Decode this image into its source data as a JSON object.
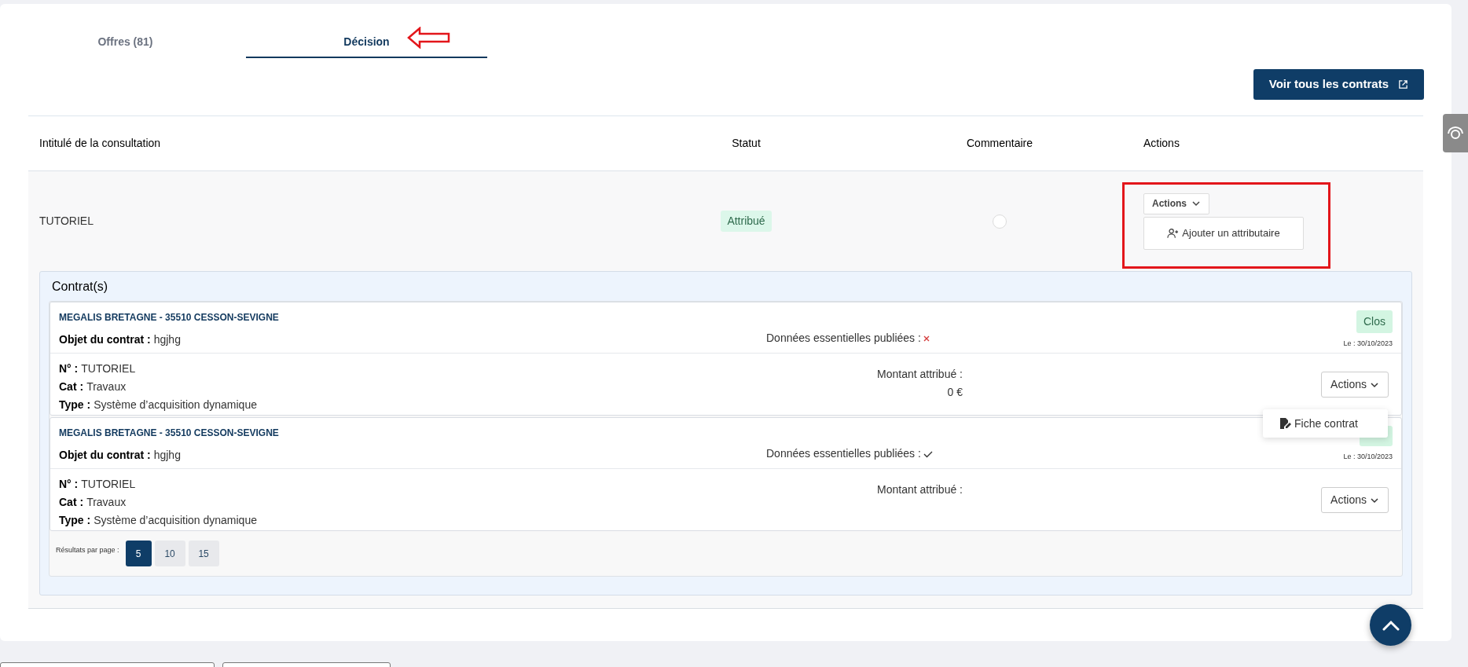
{
  "tabs": [
    {
      "label": "Offres (81)",
      "selected": false
    },
    {
      "label": "Décision",
      "selected": true
    }
  ],
  "all_contracts_button": "Voir tous les contrats",
  "table": {
    "columns": [
      "Intitulé de la consultation",
      "Statut",
      "Commentaire",
      "Actions"
    ],
    "rows": [
      {
        "title": "TUTORIEL",
        "status": "Attribué",
        "actions_button": "Actions",
        "add_button": "Ajouter un attributaire"
      }
    ]
  },
  "contracts_panel": {
    "title": "Contrat(s)",
    "contracts": [
      {
        "organization": "MEGALIS BRETAGNE - 35510 CESSON-SEVIGNE",
        "object_label": "Objet du contrat :",
        "object": "hgjhg",
        "published_label": "Données essentielles publiées :",
        "published": false,
        "status": "Clos",
        "date": "Le : 30/10/2023",
        "number_label": "N° :",
        "number": "TUTORIEL",
        "cat_label": "Cat :",
        "cat": "Travaux",
        "type_label": "Type :",
        "type": "Système d’acquisition dynamique",
        "amount_label": "Montant attribué :",
        "amount": "0 €",
        "actions_button": "Actions"
      },
      {
        "organization": "MEGALIS BRETAGNE - 35510 CESSON-SEVIGNE",
        "object_label": "Objet du contrat :",
        "object": "hgjhg",
        "published_label": "Données essentielles publiées :",
        "published": true,
        "date": "Le : 30/10/2023",
        "number_label": "N° :",
        "number": "TUTORIEL",
        "cat_label": "Cat :",
        "cat": "Travaux",
        "type_label": "Type :",
        "type": "Système d’acquisition dynamique",
        "amount_label": "Montant attribué :",
        "actions_button": "Actions"
      }
    ],
    "page_size_label": "Résultats par page :",
    "page_sizes": [
      {
        "label": "5",
        "selected": true
      },
      {
        "label": "10",
        "selected": false
      },
      {
        "label": "15",
        "selected": false
      }
    ]
  },
  "dropdown_menu": {
    "items": [
      "Fiche contrat"
    ]
  }
}
